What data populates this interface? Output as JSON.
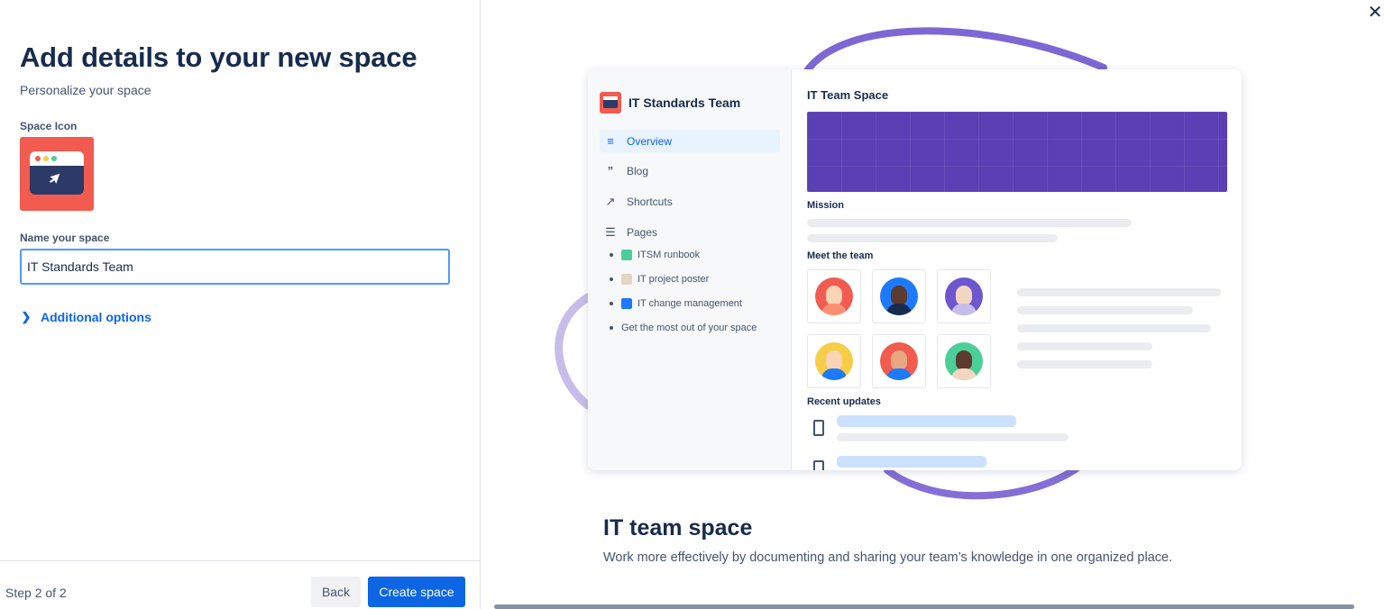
{
  "form": {
    "title": "Add details to your new space",
    "subtitle": "Personalize your space",
    "icon_label": "Space Icon",
    "name_label": "Name your space",
    "name_value": "IT Standards Team",
    "additional_options": "Additional options"
  },
  "footer": {
    "step": "Step 2 of 2",
    "back_label": "Back",
    "create_label": "Create space"
  },
  "preview": {
    "space_name": "IT Standards Team",
    "nav": [
      {
        "label": "Overview",
        "icon": "lines-icon"
      },
      {
        "label": "Blog",
        "icon": "quote-icon"
      },
      {
        "label": "Shortcuts",
        "icon": "external-link-icon"
      },
      {
        "label": "Pages",
        "icon": "page-icon"
      }
    ],
    "pages": [
      {
        "label": "ITSM runbook",
        "icon": "book-icon"
      },
      {
        "label": "IT project poster",
        "icon": "clipboard-icon"
      },
      {
        "label": "IT change management",
        "icon": "gear-icon"
      },
      {
        "label": "Get the most out of your space",
        "icon": ""
      }
    ],
    "header": "IT Team Space",
    "mission_heading": "Mission",
    "team_heading": "Meet the team",
    "recent_heading": "Recent updates"
  },
  "template": {
    "title": "IT team space",
    "description": "Work more effectively by documenting and sharing your team’s knowledge in one organized place."
  },
  "colors": {
    "primary": "#0c66e4",
    "icon_bg": "#f15b50",
    "banner": "#5a3fb5",
    "swirl": "#6e56cf"
  }
}
